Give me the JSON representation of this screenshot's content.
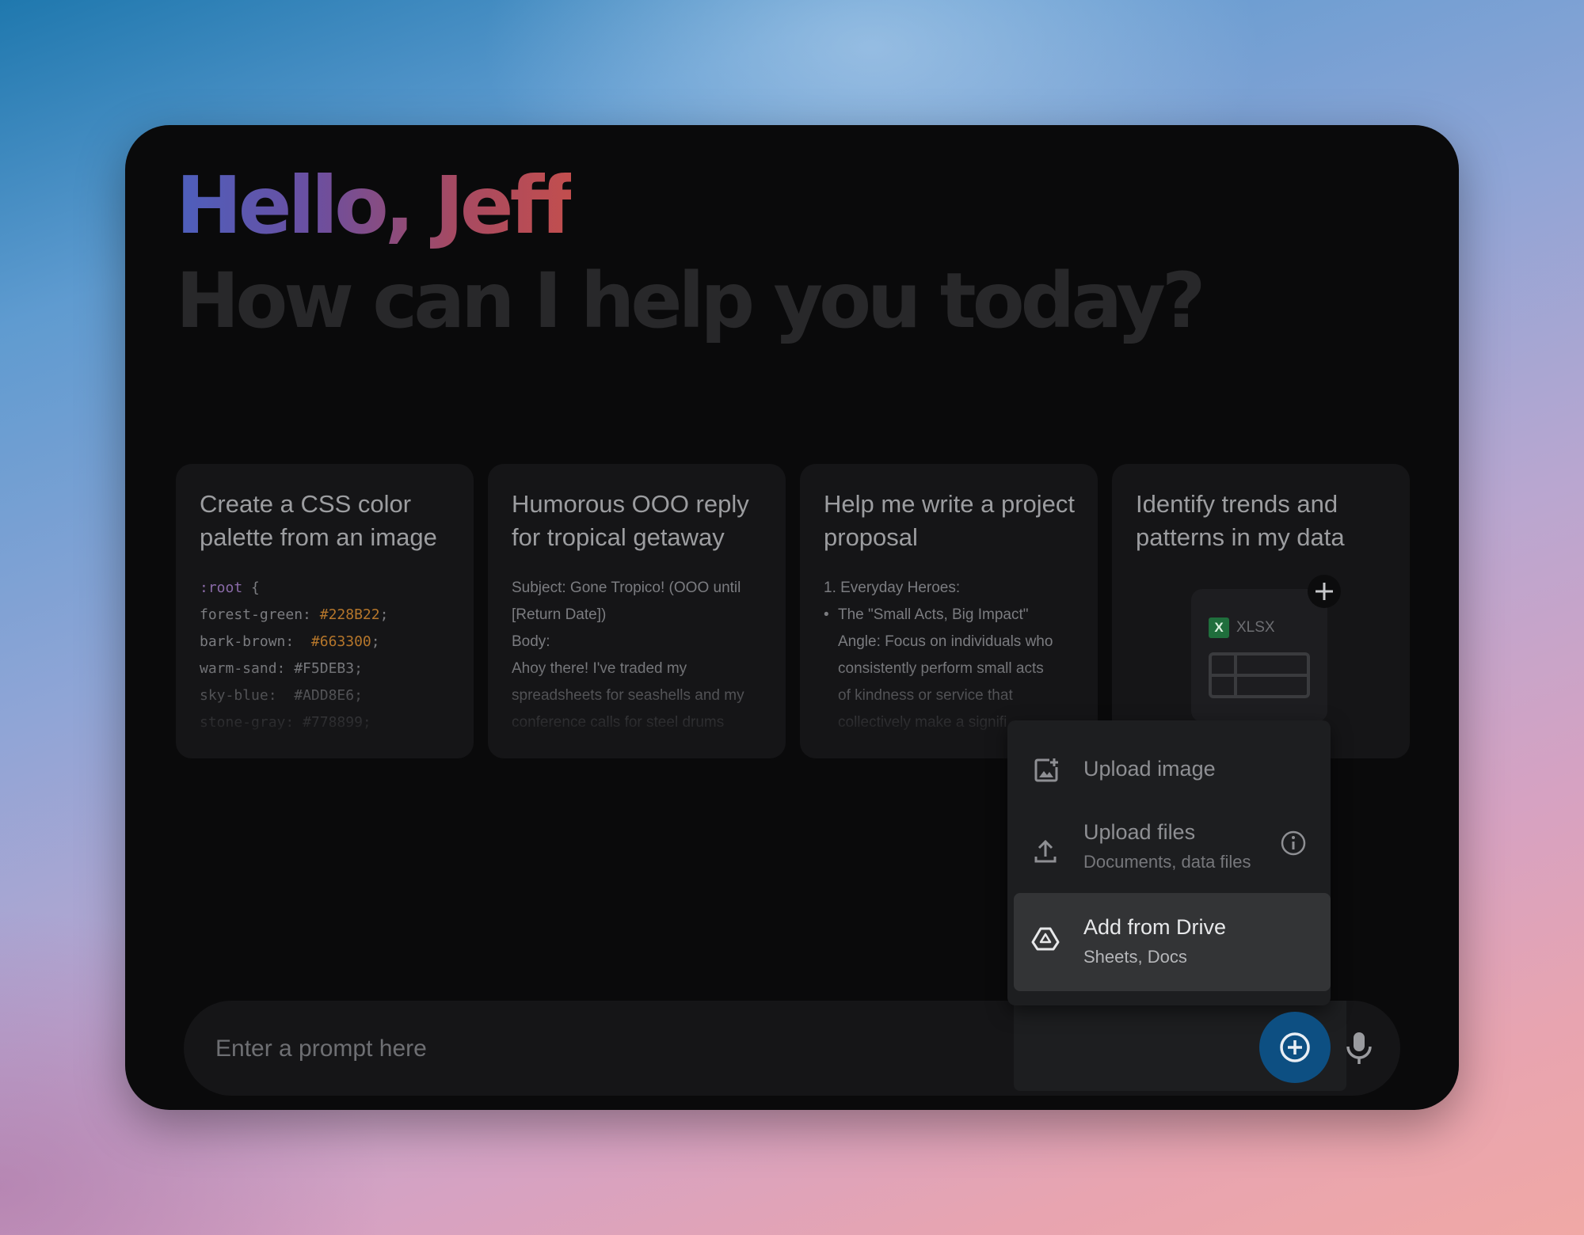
{
  "greeting": {
    "hello": "Hello, Jeff",
    "subtitle": "How can I help you today?"
  },
  "cards": [
    {
      "title": "Create a CSS color palette from an image",
      "code": {
        "open": ":root",
        "brace": " {",
        "lines": [
          {
            "name": "forest-green:",
            "value": "#228B22",
            "pad": " "
          },
          {
            "name": "bark-brown:",
            "value": "#663300",
            "pad": "  "
          },
          {
            "name": "warm-sand:",
            "value": "#F5DEB3",
            "pad": " "
          },
          {
            "name": "sky-blue:",
            "value": "#ADD8E6",
            "pad": "  "
          },
          {
            "name": "stone-gray:",
            "value": "#778899",
            "pad": " "
          }
        ]
      }
    },
    {
      "title": "Humorous OOO reply for tropical getaway",
      "body": [
        "Subject: Gone Tropico! (OOO until",
        "[Return Date])",
        "Body:",
        "Ahoy there! I've traded my",
        "spreadsheets for seashells and my",
        "conference calls for steel drums"
      ]
    },
    {
      "title": "Help me write a project proposal",
      "heading": "1. Everyday Heroes:",
      "bullet_lines": [
        "The \"Small Acts, Big Impact\"",
        "Angle: Focus on individuals who",
        "consistently perform small acts",
        "of kindness or service that",
        "collectively make a signifi"
      ]
    },
    {
      "title": "Identify trends and patterns in my data",
      "file_badge": "X",
      "file_type": "XLSX"
    }
  ],
  "menu": {
    "items": [
      {
        "label": "Upload image",
        "sub": "",
        "icon": "add-photo-icon"
      },
      {
        "label": "Upload files",
        "sub": "Documents, data files",
        "icon": "upload-icon",
        "info_icon": "info-icon"
      },
      {
        "label": "Add from Drive",
        "sub": "Sheets, Docs",
        "icon": "drive-icon",
        "highlighted": true
      }
    ]
  },
  "prompt": {
    "placeholder": "Enter a prompt here",
    "add_icon": "add-circle-icon",
    "mic_icon": "microphone-icon"
  },
  "colors": {
    "window_bg": "#0a0a0b",
    "card_bg": "#151517",
    "menu_bg": "#1d1e20",
    "highlight_bg": "#333436",
    "add_button": "#0d4f82",
    "greeting_gradient_start": "#4d5fbd",
    "greeting_gradient_end": "#c24e4e"
  }
}
